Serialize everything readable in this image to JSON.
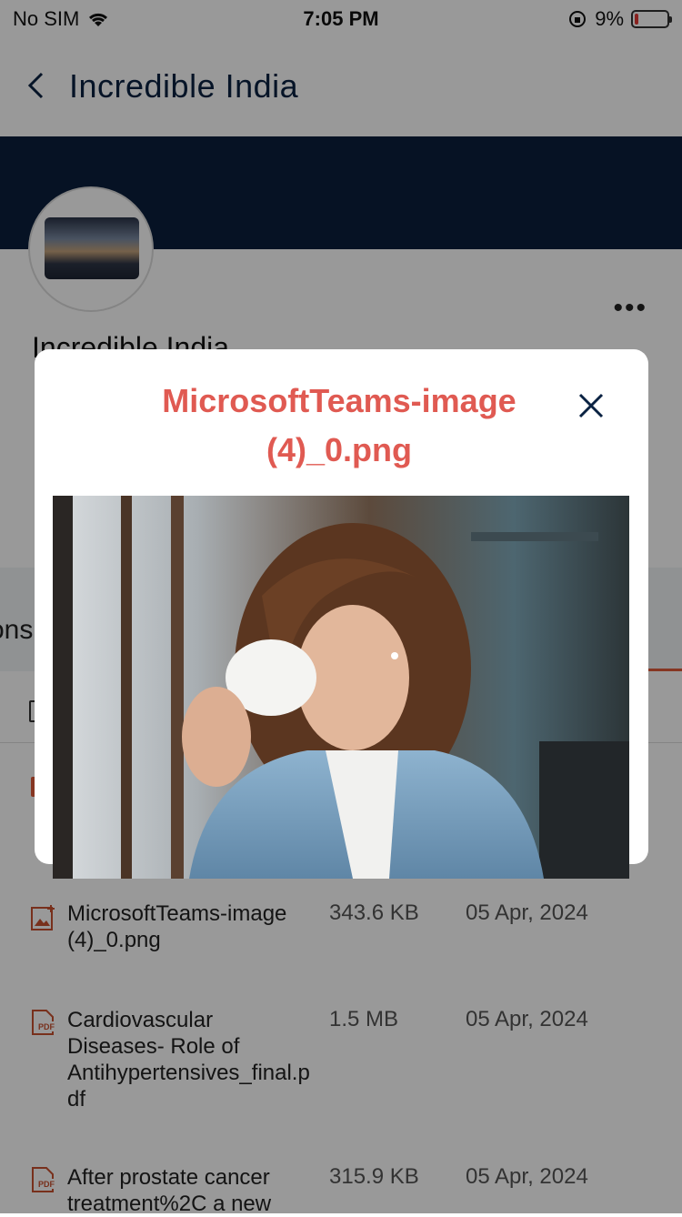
{
  "status_bar": {
    "carrier": "No SIM",
    "time": "7:05 PM",
    "battery": "9%"
  },
  "nav": {
    "title": "Incredible India"
  },
  "group": {
    "name": "Incredible India",
    "more": "•••"
  },
  "tabs": {
    "partial_label": "ons"
  },
  "files": [
    {
      "name": "MicrosoftTeams-image (4)_0.png",
      "size": "343.6 KB",
      "date": "05 Apr, 2024",
      "type": "image"
    },
    {
      "name": "Cardiovascular Diseases- Role of Antihypertensives_final.pdf",
      "size": "1.5 MB",
      "date": "05 Apr, 2024",
      "type": "pdf"
    },
    {
      "name": "After prostate cancer treatment%2C a new",
      "size": "315.9 KB",
      "date": "05 Apr, 2024",
      "type": "pdf"
    }
  ],
  "modal": {
    "title": "MicrosoftTeams-image (4)_0.png"
  },
  "colors": {
    "accent": "#e05a52",
    "navy": "#0a1f3d"
  }
}
